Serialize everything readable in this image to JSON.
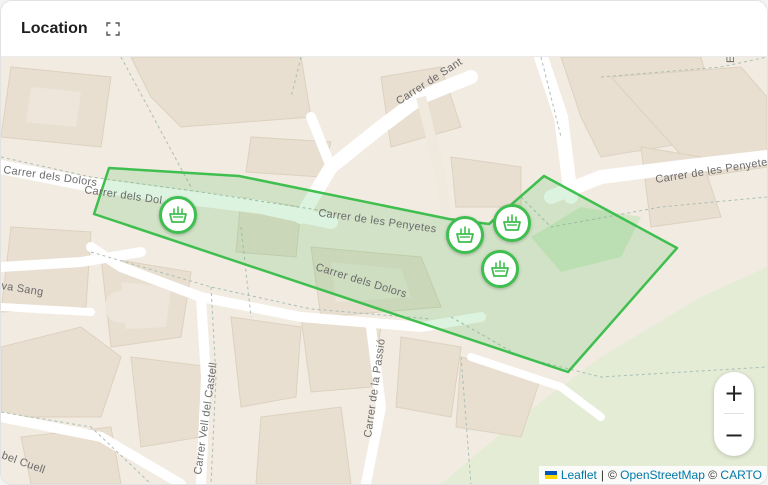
{
  "header": {
    "title": "Location"
  },
  "map": {
    "streets": {
      "carrer_de_sant": "Carrer de Sant",
      "carrer_dels_dolors_west": "Carrer dels Dolors",
      "carrer_dels_dol_marker": "Carrer dels Dol",
      "carrer_de_les_penyetes_center": "Carrer de les Penyetes",
      "carrer_de_les_penyetes_east": "Carrer de les Penyete",
      "carrer_dels_dolors_center": "Carrer dels Dolors",
      "va_sang": "va Sang",
      "carrer_vell_del_castell": "Carrer Vell del Castell",
      "carrer_de_la_passio": "Carrer de la Passió",
      "bel_cuell": "bel Cuell",
      "edge_e": "E"
    },
    "marker_icon": "basket-icon",
    "marker_count": 4,
    "area_color": "#3fbf4f",
    "area_fill": "rgba(63,191,79,0.18)"
  },
  "zoom": {
    "in_label": "+",
    "out_label": "−"
  },
  "attribution": {
    "leaflet": "Leaflet",
    "separator": "|",
    "copyright1": "©",
    "osm": "OpenStreetMap",
    "copyright2": "©",
    "carto": "CARTO"
  }
}
